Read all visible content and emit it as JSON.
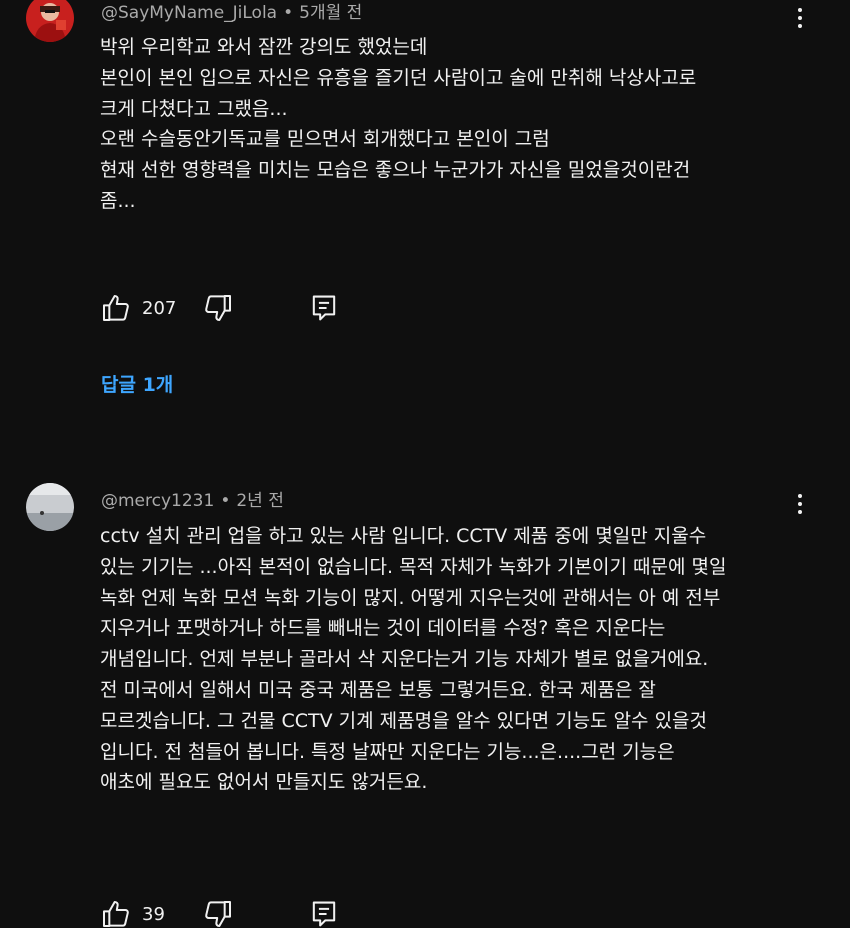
{
  "comments": [
    {
      "author": "@SayMyName_JiLola",
      "time": "5개월 전",
      "avatar_icon": "avatar-red-figure",
      "lines": [
        "박위 우리학교 와서 잠깐 강의도 했었는데",
        "본인이 본인 입으로 자신은 유흥을 즐기던 사람이고 술에 만취해 낙상사고로",
        "크게 다쳤다고 그랬음...",
        "오랜 수슬동안기독교를 믿으면서 회개했다고 본인이 그럼",
        "현재 선한 영향력을 미치는 모습은 좋으나 누군가가 자신을 밀었을것이란건",
        "좀..."
      ],
      "likes": "207",
      "replies_label": "답글 1개"
    },
    {
      "author": "@mercy1231",
      "time": "2년 전",
      "avatar_icon": "avatar-gray-photo",
      "lines": [
        "cctv 설치 관리 업을 하고 있는 사람 입니다. CCTV 제품 중에 몇일만 지울수",
        "있는 기기는 ...아직 본적이 없습니다. 목적 자체가 녹화가 기본이기 때문에 몇일",
        "녹화 언제 녹화 모션 녹화 기능이 많지. 어떻게 지우는것에 관해서는 아 예 전부",
        "지우거나 포맷하거나 하드를 빼내는 것이 데이터를 수정? 혹은 지운다는",
        "개념입니다. 언제 부분나 골라서 삭 지운다는거 기능 자체가 별로 없을거에요.",
        "전 미국에서 일해서 미국 중국 제품은 보통 그렇거든요. 한국 제품은 잘",
        "모르겟습니다. 그 건물  CCTV 기계 제품명을 알수 있다면 기능도 알수 있을것",
        "입니다. 전 첨들어 봅니다. 특정 날짜만 지운다는 기능...은....그런 기능은",
        "애초에 필요도 없어서 만들지도 않거든요."
      ],
      "likes": "39"
    }
  ],
  "separator": "•",
  "colors": {
    "background": "#0f0f0f",
    "text": "#f1f1f1",
    "secondary_text": "#aaaaaa",
    "link_blue": "#3ea6ff"
  },
  "icons": [
    "thumbs-up-icon",
    "thumbs-down-icon",
    "reply-comment-icon",
    "more-vert-icon"
  ]
}
